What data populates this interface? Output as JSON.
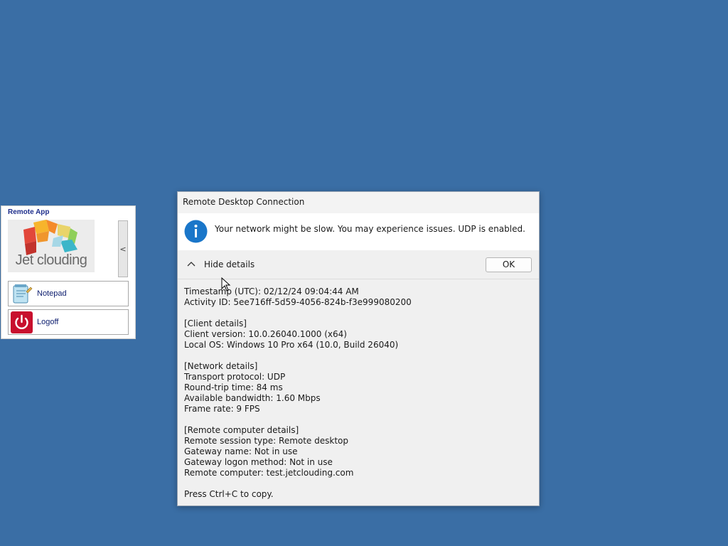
{
  "colors": {
    "desktop": "#3a6ea5",
    "info_icon": "#1a76c9",
    "logoff_icon": "#c8102e",
    "remote_app_title": "#1f2f8c"
  },
  "remote_app": {
    "title": "Remote App",
    "logo_text": "Jet clouding",
    "collapse_label": "<",
    "items": [
      {
        "label": "Notepad",
        "icon": "notepad-icon"
      },
      {
        "label": "Logoff",
        "icon": "power-icon"
      }
    ]
  },
  "dialog": {
    "title": "Remote Desktop Connection",
    "message": "Your network might be slow. You may experience issues. UDP is enabled.",
    "toggle_label": "Hide details",
    "ok_label": "OK",
    "details": {
      "timestamp": "Timestamp (UTC): 02/12/24 09:04:44 AM",
      "activity_id": "Activity ID: 5ee716ff-5d59-4056-824b-f3e999080200",
      "client_header": "[Client details]",
      "client_version": "Client version: 10.0.26040.1000 (x64)",
      "local_os": "Local OS: Windows 10 Pro x64 (10.0, Build 26040)",
      "network_header": "[Network details]",
      "transport": "Transport protocol: UDP",
      "rtt": "Round-trip time: 84 ms",
      "bandwidth": "Available bandwidth: 1.60 Mbps",
      "frame_rate": "Frame rate: 9 FPS",
      "remote_header": "[Remote computer details]",
      "session_type": "Remote session type: Remote desktop",
      "gateway_name": "Gateway name: Not in use",
      "gateway_logon": "Gateway logon method: Not in use",
      "remote_computer": "Remote computer: test.jetclouding.com",
      "copy_hint": "Press Ctrl+C to copy."
    }
  }
}
